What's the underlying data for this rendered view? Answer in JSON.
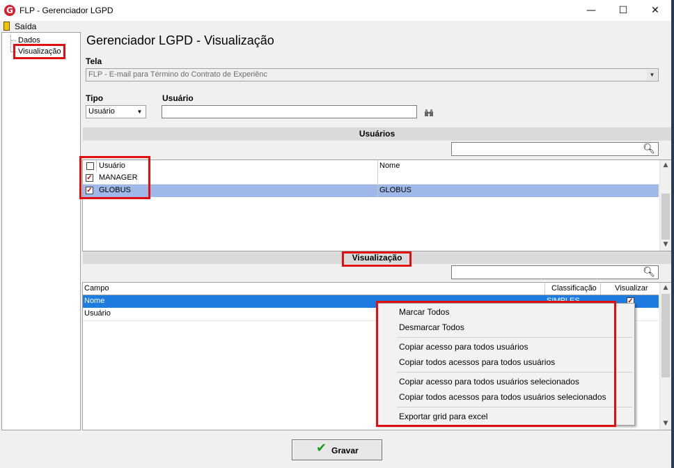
{
  "window": {
    "title": "FLP - Gerenciador LGPD",
    "app_icon_letter": "G",
    "minimize": "—",
    "maximize": "☐",
    "close": "✕"
  },
  "menu": {
    "exit_label": "Saída"
  },
  "tree": {
    "items": [
      "Dados",
      "Visualização"
    ]
  },
  "main": {
    "title": "Gerenciador LGPD - Visualização",
    "tela_label": "Tela",
    "tela_value": "FLP - E-mail para Término do Contrato de Experiênc",
    "tipo_label": "Tipo",
    "tipo_value": "Usuário",
    "usuario_label": "Usuário",
    "usuario_value": ""
  },
  "usuarios_section": {
    "header": "Usuários",
    "columns": [
      "Usuário",
      "Nome"
    ],
    "rows": [
      {
        "checked": true,
        "usuario": "MANAGER",
        "nome": ""
      },
      {
        "checked": true,
        "usuario": "GLOBUS",
        "nome": "GLOBUS"
      }
    ]
  },
  "visualizacao_section": {
    "header": "Visualização",
    "columns": [
      "Campo",
      "Classificação",
      "Visualizar"
    ],
    "rows": [
      {
        "campo": "Nome",
        "classificacao": "SIMPLES",
        "visualizar": true
      },
      {
        "campo": "Usuário",
        "classificacao": "",
        "visualizar": false
      }
    ]
  },
  "context_menu": {
    "items": [
      "Marcar Todos",
      "Desmarcar Todos",
      "Copiar acesso para todos usuários",
      "Copiar todos acessos para todos usuários",
      "Copiar acesso para todos usuários selecionados",
      "Copiar todos acessos para todos usuários selecionados",
      "Exportar grid para excel"
    ]
  },
  "footer": {
    "save_label": "Gravar"
  },
  "colors": {
    "highlight": "#e01010",
    "selected_row": "#9fb8e8",
    "selected_row_focus": "#1e7be0"
  }
}
